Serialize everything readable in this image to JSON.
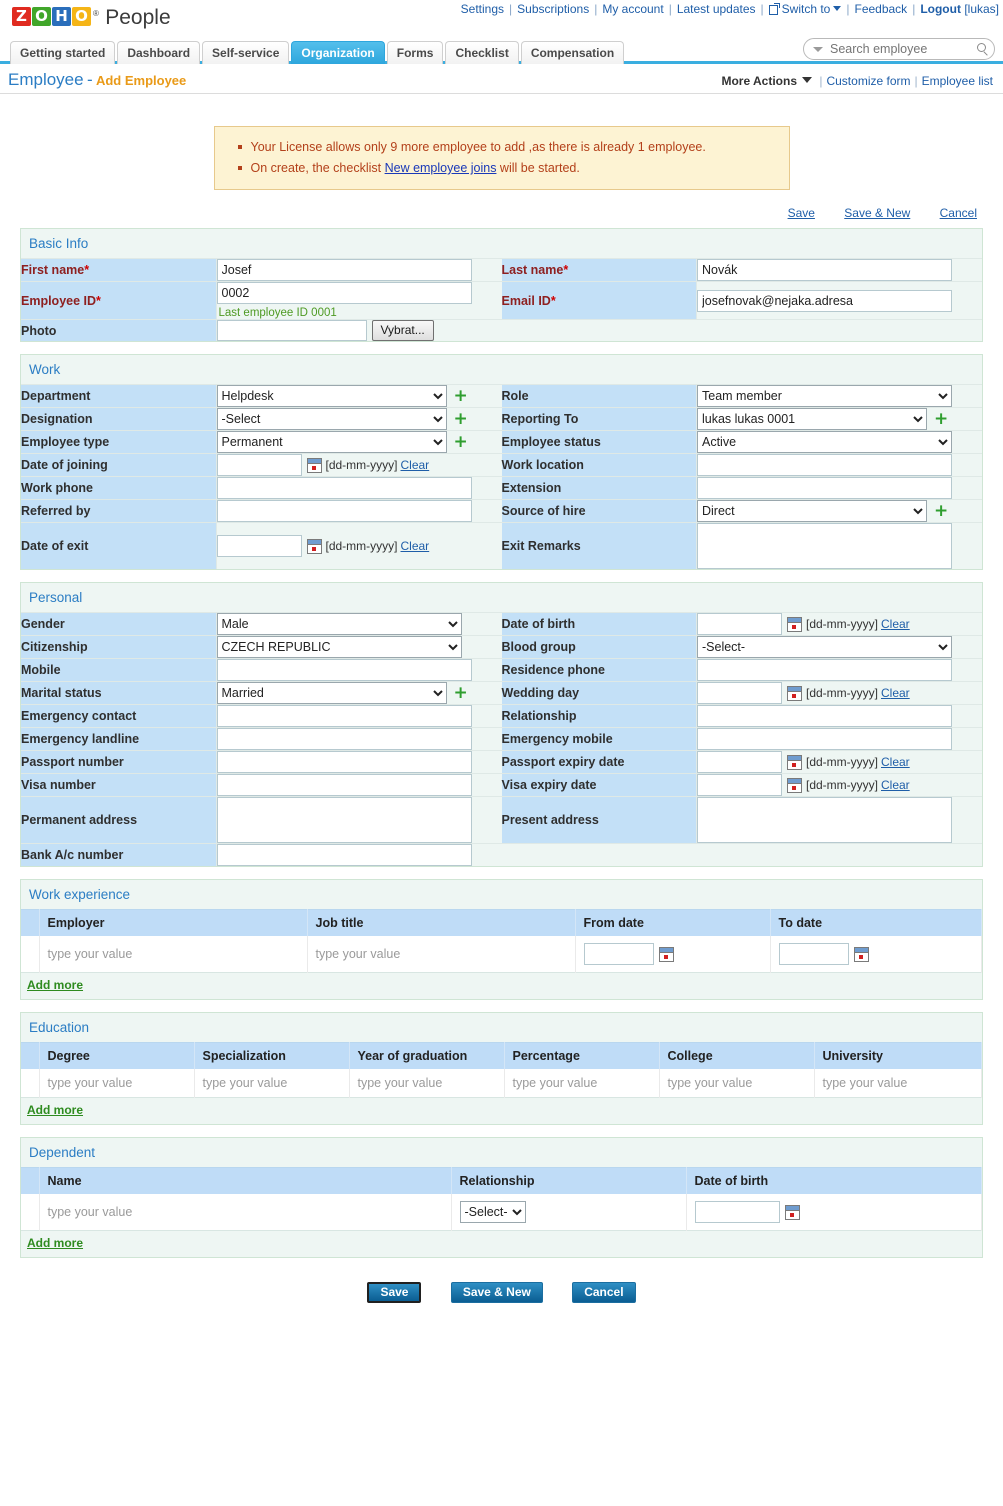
{
  "topbar": {
    "links": [
      "Settings",
      "Subscriptions",
      "My account",
      "Latest updates"
    ],
    "switch_to": "Switch to",
    "feedback": "Feedback",
    "logout": "Logout",
    "user": "[lukas]",
    "logo": {
      "letters": [
        "Z",
        "O",
        "H",
        "O"
      ],
      "reg": "®",
      "product": "People"
    }
  },
  "tabs": [
    {
      "label": "Getting started",
      "active": false
    },
    {
      "label": "Dashboard",
      "active": false
    },
    {
      "label": "Self-service",
      "active": false
    },
    {
      "label": "Organization",
      "active": true
    },
    {
      "label": "Forms",
      "active": false
    },
    {
      "label": "Checklist",
      "active": false
    },
    {
      "label": "Compensation",
      "active": false
    }
  ],
  "search": {
    "placeholder": "Search employee",
    "value": ""
  },
  "pagehead": {
    "title": "Employee",
    "dash": "-",
    "subtitle": "Add Employee",
    "more_actions": "More Actions",
    "customize_form": "Customize form",
    "employee_list": "Employee list"
  },
  "notice": {
    "line1": "Your License allows only 9 more employee to add ,as there is already 1 employee.",
    "line2_pre": "On create, the checklist ",
    "line2_link": "New employee joins",
    "line2_post": " will be started."
  },
  "savelinks": {
    "save": "Save",
    "save_new": "Save & New",
    "cancel": "Cancel"
  },
  "basic_info": {
    "title": "Basic Info",
    "first_name_label": "First name",
    "first_name_value": "Josef",
    "last_name_label": "Last name",
    "last_name_value": "Novák",
    "employee_id_label": "Employee ID",
    "employee_id_value": "0002",
    "employee_id_hint": "Last employee ID 0001",
    "email_label": "Email ID",
    "email_value": "josefnovak@nejaka.adresa",
    "photo_label": "Photo",
    "photo_value": "",
    "photo_button": "Vybrat..."
  },
  "work": {
    "title": "Work",
    "department_label": "Department",
    "department_value": "Helpdesk",
    "role_label": "Role",
    "role_value": "Team member",
    "designation_label": "Designation",
    "designation_value": "-Select",
    "reporting_to_label": "Reporting To",
    "reporting_to_value": "lukas lukas 0001",
    "employee_type_label": "Employee type",
    "employee_type_value": "Permanent",
    "employee_status_label": "Employee status",
    "employee_status_value": "Active",
    "date_of_joining_label": "Date of joining",
    "date_of_joining_value": "",
    "work_location_label": "Work location",
    "work_location_value": "",
    "work_phone_label": "Work phone",
    "work_phone_value": "",
    "extension_label": "Extension",
    "extension_value": "",
    "referred_by_label": "Referred by",
    "referred_by_value": "",
    "source_of_hire_label": "Source of hire",
    "source_of_hire_value": "Direct",
    "date_of_exit_label": "Date of exit",
    "date_of_exit_value": "",
    "exit_remarks_label": "Exit Remarks",
    "exit_remarks_value": ""
  },
  "personal": {
    "title": "Personal",
    "gender_label": "Gender",
    "gender_value": "Male",
    "dob_label": "Date of birth",
    "dob_value": "",
    "citizenship_label": "Citizenship",
    "citizenship_value": "CZECH REPUBLIC",
    "blood_group_label": "Blood group",
    "blood_group_value": "-Select-",
    "mobile_label": "Mobile",
    "mobile_value": "",
    "residence_phone_label": "Residence phone",
    "residence_phone_value": "",
    "marital_status_label": "Marital status",
    "marital_status_value": "Married",
    "wedding_day_label": "Wedding day",
    "wedding_day_value": "",
    "emergency_contact_label": "Emergency contact",
    "emergency_contact_value": "",
    "relationship_label": "Relationship",
    "relationship_value": "",
    "emergency_landline_label": "Emergency landline",
    "emergency_landline_value": "",
    "emergency_mobile_label": "Emergency mobile",
    "emergency_mobile_value": "",
    "passport_number_label": "Passport number",
    "passport_number_value": "",
    "passport_expiry_label": "Passport expiry date",
    "passport_expiry_value": "",
    "visa_number_label": "Visa number",
    "visa_number_value": "",
    "visa_expiry_label": "Visa expiry date",
    "visa_expiry_value": "",
    "permanent_address_label": "Permanent address",
    "permanent_address_value": "",
    "present_address_label": "Present address",
    "present_address_value": "",
    "bank_ac_label": "Bank A/c number",
    "bank_ac_value": ""
  },
  "date_format": "[dd-mm-yyyy]",
  "clear_label": "Clear",
  "placeholder_cell": "type your value",
  "add_more": "Add more",
  "work_experience": {
    "title": "Work experience",
    "columns": [
      "Employer",
      "Job title",
      "From date",
      "To date"
    ],
    "row": {
      "employer": "type your value",
      "job_title": "type your value",
      "from_date": "",
      "to_date": ""
    }
  },
  "education": {
    "title": "Education",
    "columns": [
      "Degree",
      "Specialization",
      "Year of graduation",
      "Percentage",
      "College",
      "University"
    ],
    "row": [
      "type your value",
      "type your value",
      "type your value",
      "type your value",
      "type your value",
      "type your value"
    ]
  },
  "dependent": {
    "title": "Dependent",
    "columns": [
      "Name",
      "Relationship",
      "Date of birth"
    ],
    "row": {
      "name": "type your value",
      "relationship": "-Select-",
      "dob": ""
    }
  },
  "footer": {
    "save": "Save",
    "save_new": "Save & New",
    "cancel": "Cancel"
  },
  "colors": {
    "accent_blue": "#2b7dc4",
    "tab_active": "#2ea6dd",
    "label_cell": "#c3e0f7",
    "section_bg": "#eef6f3",
    "required_label": "#8e2020",
    "notice_bg": "#fdf3d3",
    "notice_text": "#b3401a",
    "link": "#1f5ea8",
    "green_hint": "#4e9a23",
    "plus_green": "#2f9e2f",
    "subtitle_orange": "#e99a18"
  }
}
